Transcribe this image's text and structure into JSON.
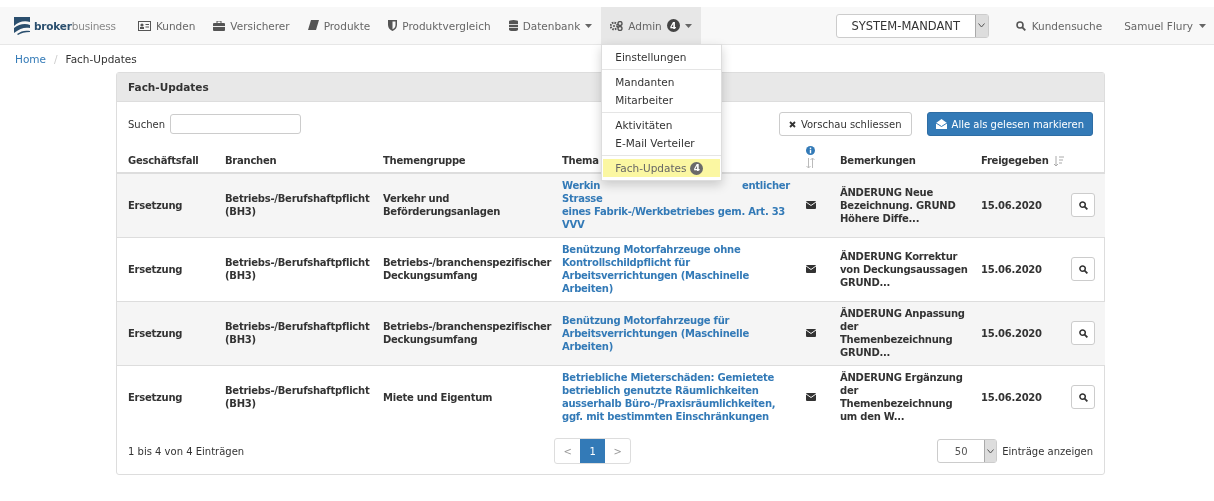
{
  "navbar": {
    "brand": {
      "strong": "broker",
      "light": "business"
    },
    "items": [
      {
        "label": "Kunden",
        "selected": false
      },
      {
        "label": "Versicherer",
        "selected": false
      },
      {
        "label": "Produkte",
        "selected": false
      },
      {
        "label": "Produktvergleich",
        "selected": false
      },
      {
        "label": "Datenbank",
        "selected": false,
        "caret": true
      },
      {
        "label": "Admin",
        "selected": true,
        "caret": true,
        "badge": "4"
      }
    ],
    "mandant": "SYSTEM-MANDANT",
    "search_link": "Kundensuche",
    "user": "Samuel Flury"
  },
  "admin_menu": [
    [
      {
        "label": "Einstellungen",
        "selected": false
      }
    ],
    [
      {
        "label": "Mandanten",
        "selected": false
      },
      {
        "label": "Mitarbeiter",
        "selected": false
      }
    ],
    [
      {
        "label": "Aktivitäten",
        "selected": false
      },
      {
        "label": "E-Mail Verteiler",
        "selected": false
      }
    ],
    [
      {
        "label": "Fach-Updates",
        "selected": true,
        "badge": "4"
      }
    ]
  ],
  "breadcrumb": {
    "items": [
      "Home",
      "Fach-Updates"
    ],
    "separator": "/"
  },
  "panel": {
    "title": "Fach-Updates",
    "search_label": "Suchen",
    "close_preview": "Vorschau schliessen",
    "mark_all_read": "Alle als gelesen markieren",
    "columns": [
      "Geschäftsfall",
      "Branchen",
      "Themengruppe",
      "Thema",
      "Bemerkungen",
      "Freigegeben"
    ],
    "rows": [
      {
        "geschaeftsfall": "Ersetzung",
        "branchen": "Betriebs-/Berufshaftpflicht (BH3)",
        "themengruppe": "Verkehr und Beförderungsanlagen",
        "thema_visible": [
          [
            "Werkin",
            "entlicher"
          ],
          [
            "Strasse"
          ],
          [
            "eines Fabrik-/Werkbetriebes gem. Art. 33 VVV"
          ]
        ],
        "bemerkungen": "ÄNDERUNG Neue Bezeichnung. GRUND Höhere Diffe...",
        "freigegeben": "15.06.2020"
      },
      {
        "geschaeftsfall": "Ersetzung",
        "branchen": "Betriebs-/Berufshaftpflicht (BH3)",
        "themengruppe": "Betriebs-/branchenspezifischer Deckungsumfang",
        "thema": "Benützung Motorfahrzeuge ohne Kontrollschildpflicht für Arbeitsverrichtungen (Maschinelle Arbeiten)",
        "bemerkungen": "ÄNDERUNG Korrektur von Deckungsaussagen GRUND...",
        "freigegeben": "15.06.2020"
      },
      {
        "geschaeftsfall": "Ersetzung",
        "branchen": "Betriebs-/Berufshaftpflicht (BH3)",
        "themengruppe": "Betriebs-/branchenspezifischer Deckungsumfang",
        "thema": "Benützung Motorfahrzeuge für Arbeitsverrichtungen (Maschinelle Arbeiten)",
        "bemerkungen": "ÄNDERUNG Anpassung der Themenbezeichnung GRUND...",
        "freigegeben": "15.06.2020"
      },
      {
        "geschaeftsfall": "Ersetzung",
        "branchen": "Betriebs-/Berufshaftpflicht (BH3)",
        "themengruppe": "Miete und Eigentum",
        "thema": "Betriebliche Mieterschäden: Gemietete betrieblich genutzte Räumlichkeiten ausserhalb Büro-/Praxisräumlichkeiten, ggf. mit bestimmten Einschränkungen",
        "bemerkungen": "ÄNDERUNG Ergänzung der Themenbezeichnung um den W...",
        "freigegeben": "15.06.2020"
      }
    ],
    "info": "1 bis 4 von 4 Einträgen",
    "pagination": {
      "prev": "<",
      "pages": [
        {
          "label": "1",
          "selected": true
        }
      ],
      "next": ">"
    },
    "page_size": "50",
    "page_size_label": "Einträge anzeigen"
  }
}
